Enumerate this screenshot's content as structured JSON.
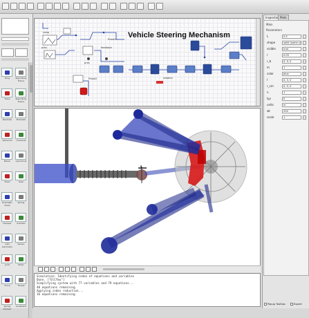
{
  "diagram": {
    "title": "Vehicle Steering Mechanism",
    "labels": {
      "ramp": "ramp",
      "feedback": "feedback",
      "prbs1": "prbs",
      "prbs2": "prbs",
      "probe1": "Probe1",
      "probe2": "Probe2",
      "rot": "rotation"
    }
  },
  "library": {
    "items": [
      {
        "label": "Ring"
      },
      {
        "label": "Rigid Body Frame"
      },
      {
        "label": "Trans"
      },
      {
        "label": "Rigid Body Frame"
      },
      {
        "label": "Revolute"
      },
      {
        "label": "Prismatic"
      },
      {
        "label": "Spherical"
      },
      {
        "label": "Universal"
      },
      {
        "label": "Planar"
      },
      {
        "label": "Cylindrical"
      },
      {
        "label": "Fixed"
      },
      {
        "label": "Gear"
      },
      {
        "label": "Kinematic Chain"
      },
      {
        "label": "Spring"
      },
      {
        "label": "Damper"
      },
      {
        "label": "Actuator"
      },
      {
        "label": "CAD Geometry"
      },
      {
        "label": "Sensor"
      },
      {
        "label": "Joint"
      },
      {
        "label": "Motor"
      },
      {
        "label": "Force"
      },
      {
        "label": "Torque"
      },
      {
        "label": "Spring Damper"
      },
      {
        "label": "Constraint"
      }
    ]
  },
  "inspector": {
    "tabs": [
      "Inspector",
      "Plots"
    ],
    "header": "Main",
    "section": "Parameters",
    "params": [
      {
        "name": "L",
        "value": "0.5"
      },
      {
        "name": "shape",
        "value": "solid (same size)"
      },
      {
        "name": "visible",
        "value": "true"
      },
      {
        "name": "r",
        "value": "0.05"
      },
      {
        "name": "r_b",
        "value": "0, 0, 0"
      },
      {
        "name": "m",
        "value": "1"
      },
      {
        "name": "color",
        "value": "blue"
      },
      {
        "name": "I",
        "value": "0, 0, 0"
      },
      {
        "name": "r_cm",
        "value": "0, 0, 0"
      },
      {
        "name": "n",
        "value": "1"
      },
      {
        "name": "Iyy",
        "value": "0"
      },
      {
        "name": "units",
        "value": "m"
      },
      {
        "name": "wt",
        "value": "200"
      },
      {
        "name": "scale",
        "value": "1"
      }
    ],
    "checkboxes": {
      "show_tooltips": "Popup Tooltips",
      "expert": "Expert"
    }
  },
  "log": {
    "lines": [
      "Simulation: Identifying index of equations and variables",
      "Done. [\"ElCfmu\"]",
      "Simplifying system with 77 variables and 79 equations...",
      "40 equations remaining.",
      "Applying index reduction...",
      "16 equations remaining."
    ]
  },
  "marker": {
    "label": "1"
  }
}
